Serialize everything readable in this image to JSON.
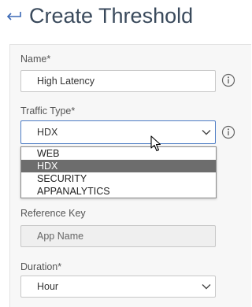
{
  "header": {
    "title": "Create Threshold"
  },
  "form": {
    "name": {
      "label": "Name*",
      "value": "High Latency"
    },
    "traffic_type": {
      "label": "Traffic Type*",
      "value": "HDX",
      "options": [
        "WEB",
        "HDX",
        "SECURITY",
        "APPANALYTICS"
      ],
      "selected_index": 1
    },
    "reference_key": {
      "label": "Reference Key",
      "value": "App Name"
    },
    "duration": {
      "label": "Duration*",
      "value": "Hour"
    }
  },
  "icons": {
    "back": "back-arrow-icon",
    "info": "info-icon",
    "chevron": "chevron-down-icon",
    "cursor": "mouse-cursor-icon"
  },
  "colors": {
    "title": "#3a4a5c",
    "focus_border": "#4d7cc4",
    "selected_option": "#6d6d6d"
  }
}
